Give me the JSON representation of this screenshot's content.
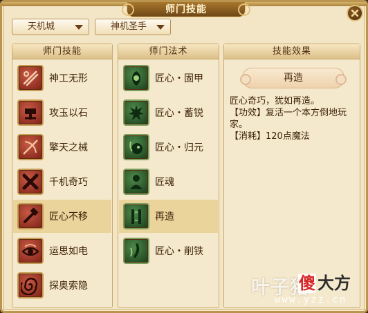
{
  "window": {
    "title": "师门技能",
    "close_icon": "close-icon"
  },
  "filters": {
    "city": "天机城",
    "sect": "神机圣手"
  },
  "skills_panel": {
    "header": "师门技能",
    "items": [
      {
        "label": "神工无形",
        "icon": "slash-icon",
        "selected": false
      },
      {
        "label": "攻玉以石",
        "icon": "stone-hammer-icon",
        "selected": false
      },
      {
        "label": "擎天之械",
        "icon": "bow-mechanism-icon",
        "selected": false
      },
      {
        "label": "千机奇巧",
        "icon": "crossed-tools-icon",
        "selected": false
      },
      {
        "label": "匠心不移",
        "icon": "hammer-icon",
        "selected": true
      },
      {
        "label": "运思如电",
        "icon": "eye-vortex-icon",
        "selected": false
      },
      {
        "label": "探奥索隐",
        "icon": "spiral-icon",
        "selected": false
      }
    ]
  },
  "spells_panel": {
    "header": "师门法术",
    "items": [
      {
        "label": "匠心・固甲",
        "icon": "shield-leaf-icon",
        "selected": false
      },
      {
        "label": "匠心・蓄锐",
        "icon": "spiky-figure-icon",
        "selected": false
      },
      {
        "label": "匠心・归元",
        "icon": "bomb-ring-icon",
        "selected": false
      },
      {
        "label": "匠魂",
        "icon": "soul-figure-icon",
        "selected": false
      },
      {
        "label": "再造",
        "icon": "pillars-icon",
        "selected": true
      },
      {
        "label": "匠心・削铁",
        "icon": "blade-icon",
        "selected": false
      }
    ]
  },
  "effect_panel": {
    "header": "技能效果",
    "skill_name": "再造",
    "description": "匠心奇巧，犹如再造。",
    "effect_line": "【功效】复活一个本方倒地玩家。",
    "cost_line": "【消耗】120点魔法"
  },
  "watermark": {
    "main": "叶子猪",
    "badge": "傻",
    "rest": "大方",
    "url": "www.yzz.cn"
  },
  "colors": {
    "skill_icon_bg": "#7e1f16",
    "spell_icon_bg": "#173d1b",
    "selected_row": "#ebd39c",
    "panel_bg": "#f5e9cd"
  }
}
